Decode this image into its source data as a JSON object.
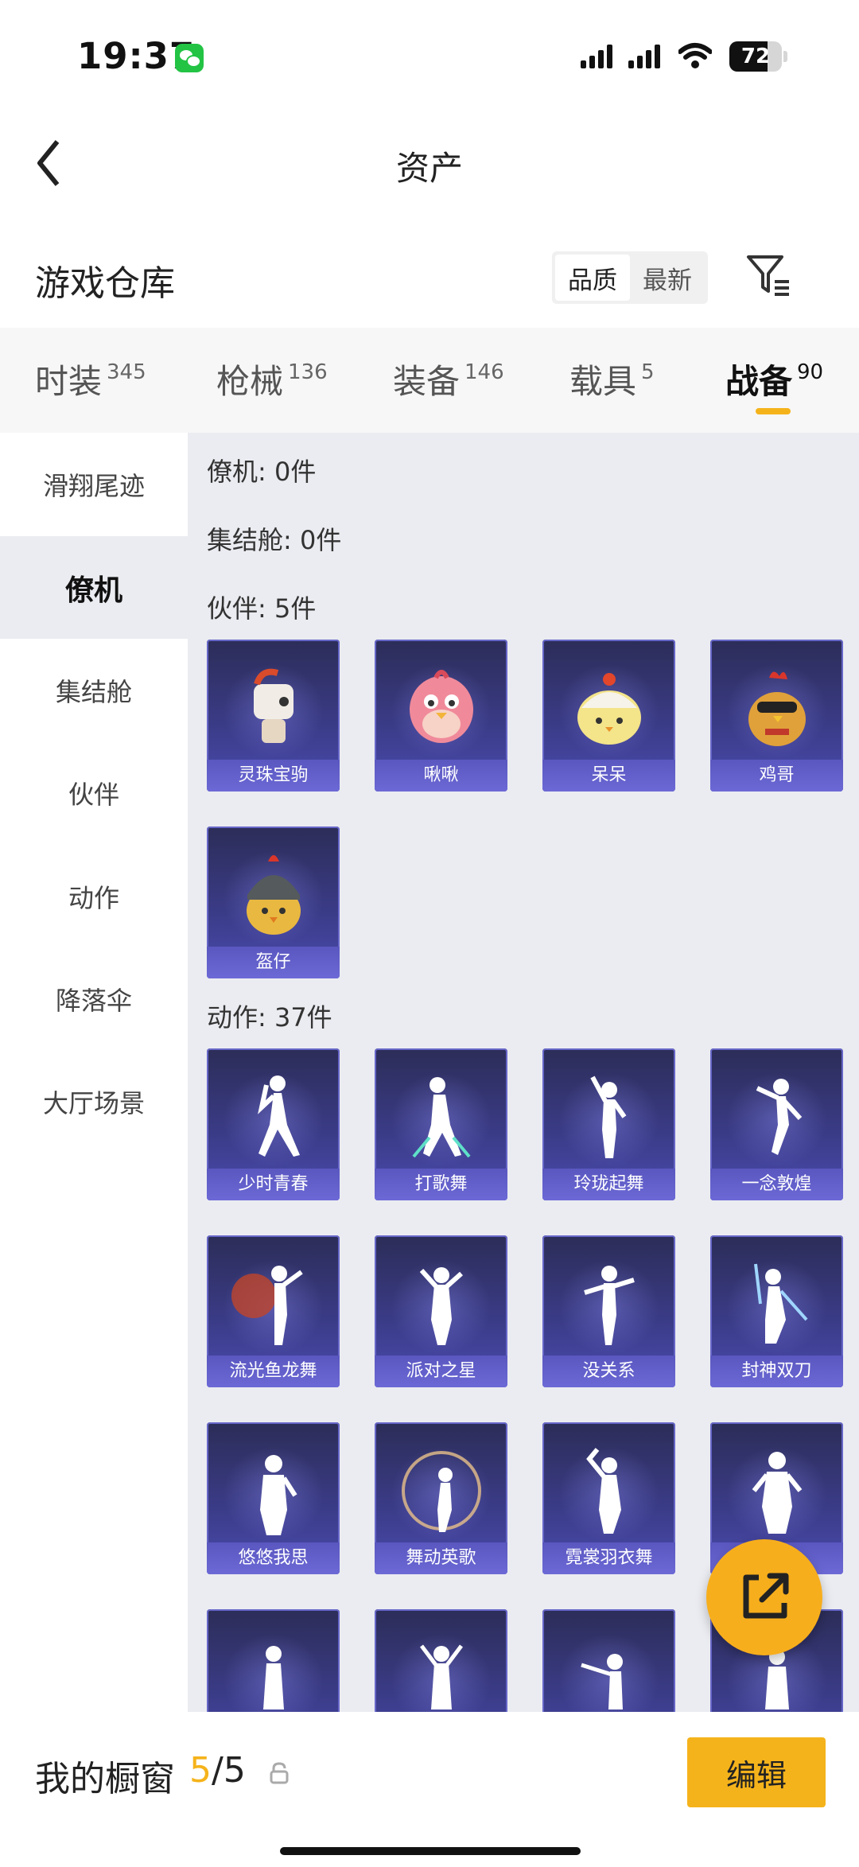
{
  "status_bar": {
    "time": "19:37",
    "battery": "72"
  },
  "nav": {
    "title": "资产"
  },
  "warehouse": {
    "title": "游戏仓库",
    "sort_options": [
      "品质",
      "最新"
    ]
  },
  "tabs": [
    {
      "label": "时装",
      "count": "345"
    },
    {
      "label": "枪械",
      "count": "136"
    },
    {
      "label": "装备",
      "count": "146"
    },
    {
      "label": "载具",
      "count": "5"
    },
    {
      "label": "战备",
      "count": "90"
    }
  ],
  "sidebar": {
    "items": [
      "滑翔尾迹",
      "僚机",
      "集结舱",
      "伙伴",
      "动作",
      "降落伞",
      "大厅场景"
    ]
  },
  "sections": {
    "wingman": "僚机: 0件",
    "rally_pod": "集结舱: 0件",
    "partner": "伙伴: 5件",
    "action": "动作: 37件"
  },
  "partners": [
    "灵珠宝驹",
    "啾啾",
    "呆呆",
    "鸡哥",
    "盔仔"
  ],
  "actions": [
    "少时青春",
    "打歌舞",
    "玲珑起舞",
    "一念敦煌",
    "流光鱼龙舞",
    "派对之星",
    "没关系",
    "封神双刀",
    "悠悠我思",
    "舞动英歌",
    "霓裳羽衣舞"
  ],
  "bottom": {
    "label": "我的橱窗",
    "current": "5",
    "total": "/5",
    "edit": "编辑"
  }
}
